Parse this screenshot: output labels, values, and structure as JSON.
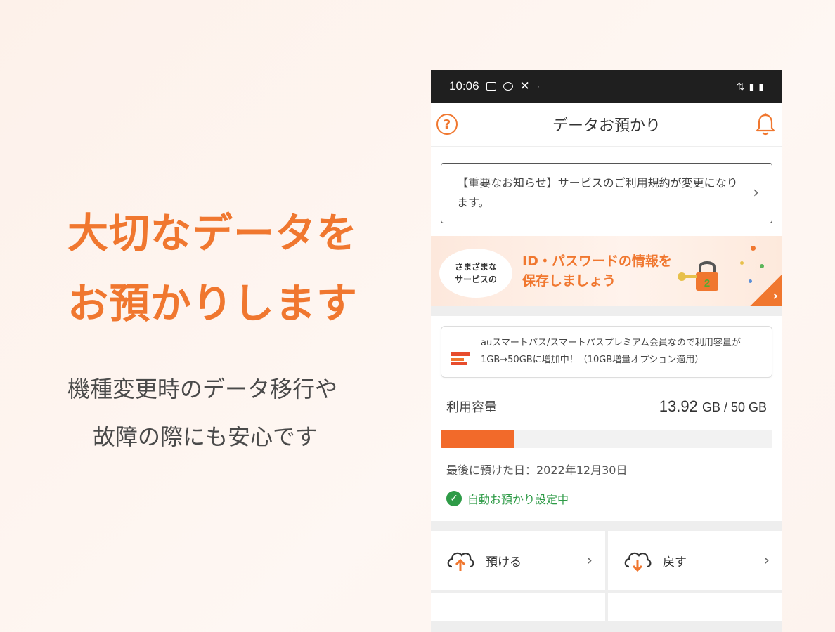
{
  "promo": {
    "headline_line1": "大切なデータを",
    "headline_line2": "お預かりします",
    "sub_line1": "機種変更時のデータ移行や",
    "sub_line2": "故障の際にも安心です"
  },
  "statusbar": {
    "time": "10:06"
  },
  "appbar": {
    "title": "データお預かり"
  },
  "notice": {
    "text": "【重要なお知らせ】サービスのご利用規約が変更になります。"
  },
  "banner": {
    "bubble_line1": "さまざまな",
    "bubble_line2": "サービスの",
    "text_line1": "ID・パスワードの情報を",
    "text_line2": "保存しましょう",
    "lock_number": "2"
  },
  "storage": {
    "tip": "auスマートパス/スマートパスプレミアム会員なので利用容量が1GB→50GBに増加中！（10GB増量オプション適用）",
    "usage_label": "利用容量",
    "used_value": "13.92",
    "used_unit": "GB",
    "separator": " / ",
    "total": "50 GB",
    "usage_fraction": 0.2235,
    "last_date": "最後に預けた日：2022年12月30日",
    "auto_status": "自動お預かり設定中"
  },
  "actions": [
    {
      "label": "預ける"
    },
    {
      "label": "戻す"
    }
  ],
  "colors": {
    "accent": "#f0772f",
    "success": "#2e9b47",
    "bar": "#f26a2a"
  }
}
